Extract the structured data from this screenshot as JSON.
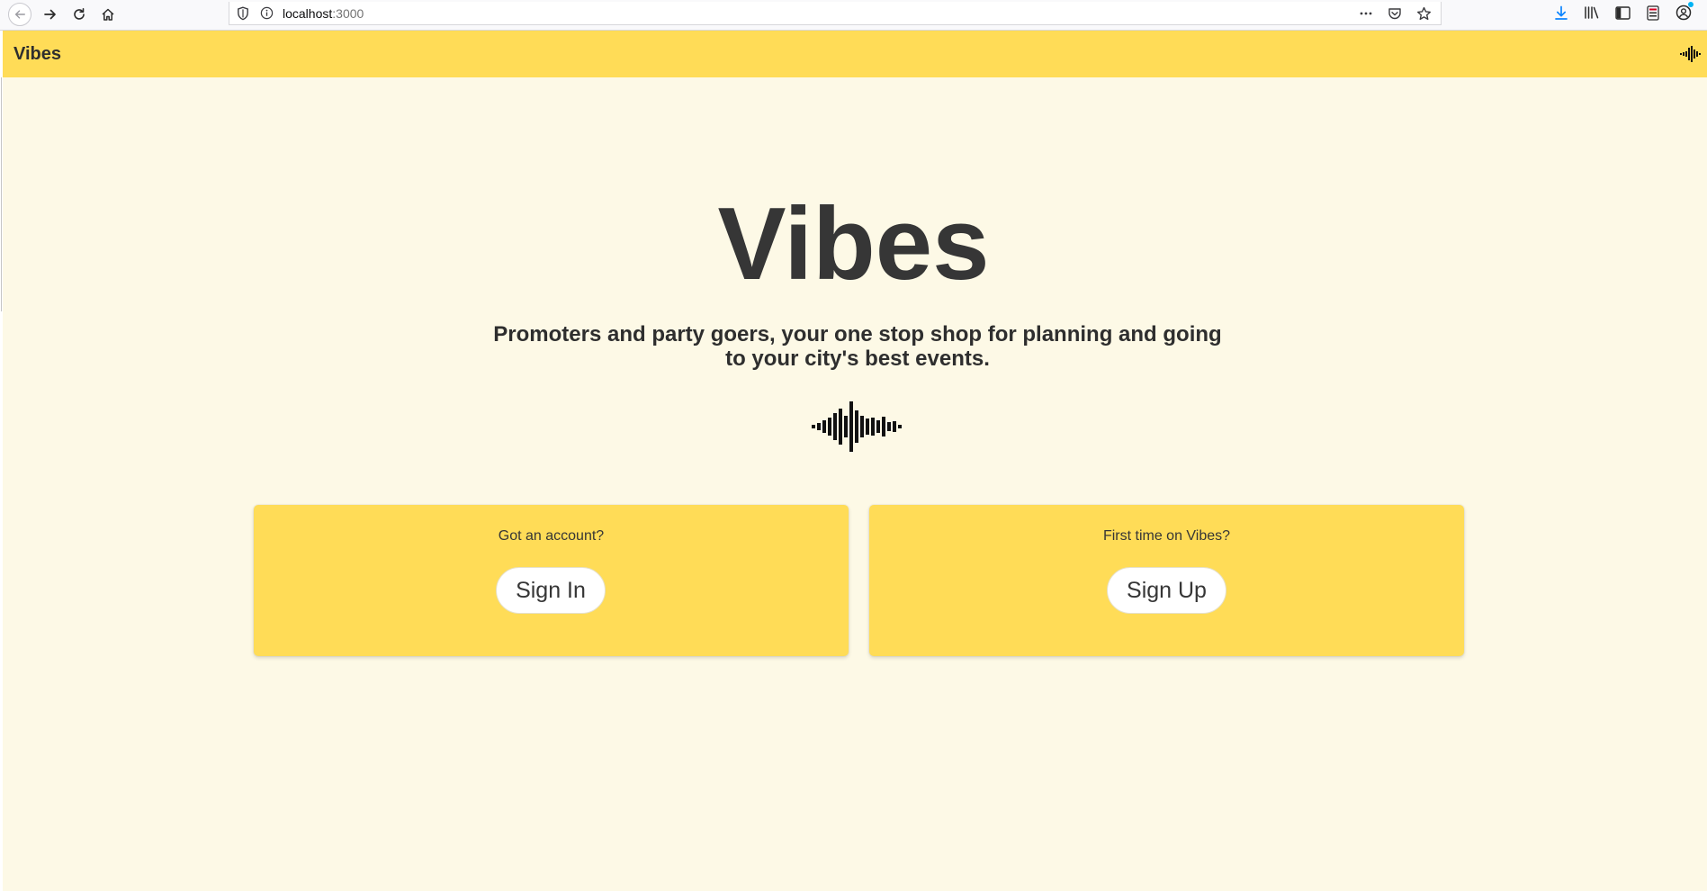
{
  "browser": {
    "url_host": "localhost",
    "url_port": ":3000"
  },
  "navbar": {
    "brand": "Vibes",
    "logo_icon": "soundwave-icon"
  },
  "hero": {
    "title": "Vibes",
    "subtitle": "Promoters and party goers, your one stop shop for planning and going to your city's best events.",
    "icon": "soundwave-icon"
  },
  "cards": {
    "signin": {
      "prompt": "Got an account?",
      "button_label": "Sign In"
    },
    "signup": {
      "prompt": "First time on Vibes?",
      "button_label": "Sign Up"
    }
  },
  "colors": {
    "accent": "#ffdc57",
    "background": "#fdf9e6",
    "text": "#363636",
    "button": "#ffffff"
  }
}
